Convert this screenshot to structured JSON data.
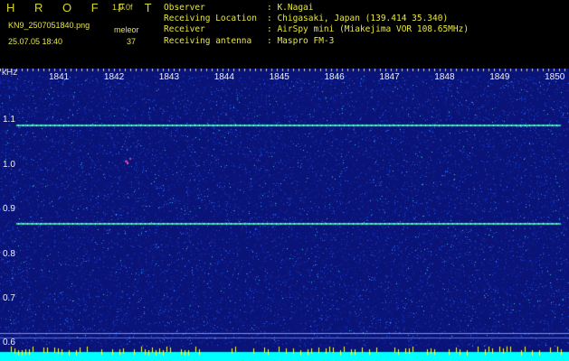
{
  "header": {
    "title": "H R O F F T",
    "version": "1.0.0f",
    "filename": "KN9_2507051840.png",
    "datetime": "25.07.05 18:40",
    "mode": "meleor",
    "count": "37"
  },
  "station": {
    "rows": [
      {
        "label": "Observer",
        "value": ": K.Nagai"
      },
      {
        "label": "Receiving Location",
        "value": ": Chigasaki, Japan (139.414 35.340)"
      },
      {
        "label": "Receiver",
        "value": ": AirSpy mini (Miakejima VOR 108.65MHz)"
      },
      {
        "label": "Receiving antenna",
        "value": ": Maspro FM-3"
      }
    ]
  },
  "colors": {
    "background": "#0a1478",
    "noise": [
      "#0f2aa8",
      "#1e46d8",
      "#2f6cff",
      "#39c8d8",
      "#00ffff"
    ],
    "tone_line": "#2bd7a8",
    "label": "#e8e83c"
  },
  "spectrogram": {
    "y_unit": "kHz",
    "x_ticks": [
      "1841",
      "1842",
      "1843",
      "1844",
      "1845",
      "1846",
      "1847",
      "1848",
      "1849",
      "1850"
    ],
    "y_ticks": [
      "1.1",
      "1.0",
      "0.9",
      "0.8",
      "0.7",
      "0.6"
    ],
    "y_range": [
      0.575,
      1.2
    ],
    "tone_lines_khz": [
      1.09,
      0.87
    ],
    "meteor_echo": {
      "time": "1842.2",
      "freq_khz": 1.01
    }
  }
}
